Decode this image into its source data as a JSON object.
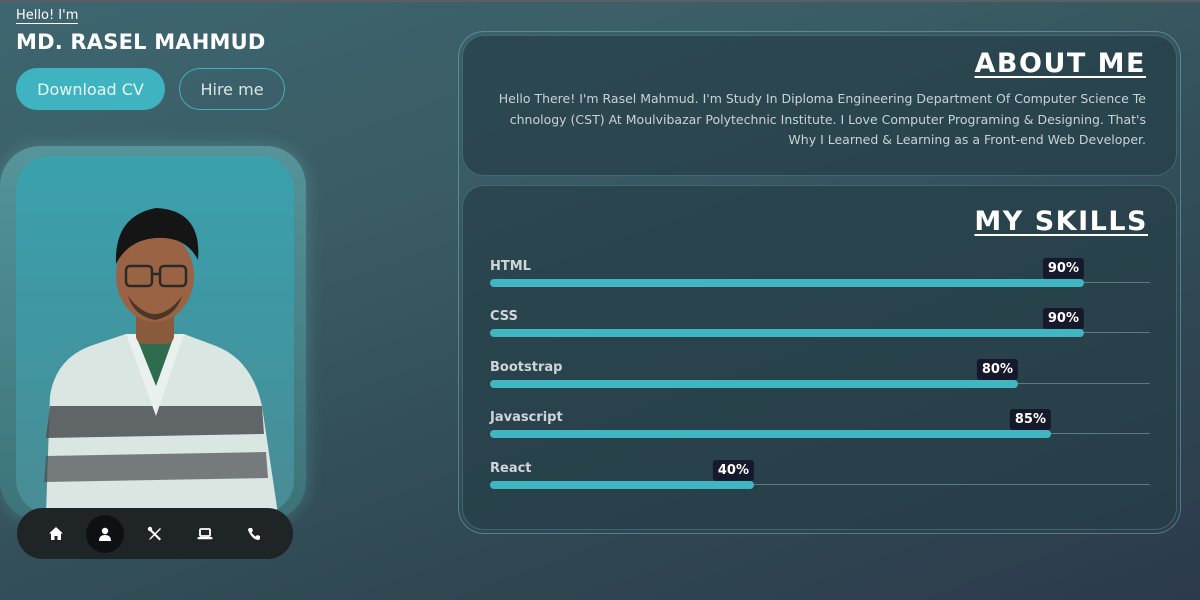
{
  "intro": {
    "greeting": "Hello! I'm",
    "name": "MD. RASEL MAHMUD"
  },
  "buttons": {
    "download": "Download CV",
    "hire": "Hire me"
  },
  "nav": {
    "items": [
      {
        "icon": "home-icon",
        "active": false
      },
      {
        "icon": "user-icon",
        "active": true
      },
      {
        "icon": "tools-icon",
        "active": false
      },
      {
        "icon": "laptop-icon",
        "active": false
      },
      {
        "icon": "phone-icon",
        "active": false
      }
    ]
  },
  "about": {
    "title": "ABOUT ME",
    "text": "Hello There! I'm Rasel Mahmud. I'm Study In Diploma Engineering Department Of Computer Science Te chnology (CST) At Moulvibazar Polytechnic Institute. I Love Computer Programing & Designing. That's Why I Learned & Learning as a Front-end Web Developer."
  },
  "skills": {
    "title": "MY SKILLS",
    "items": [
      {
        "name": "HTML",
        "percent": 90,
        "label": "90%"
      },
      {
        "name": "CSS",
        "percent": 90,
        "label": "90%"
      },
      {
        "name": "Bootstrap",
        "percent": 80,
        "label": "80%"
      },
      {
        "name": "Javascript",
        "percent": 85,
        "label": "85%"
      },
      {
        "name": "React",
        "percent": 40,
        "label": "40%"
      }
    ]
  },
  "colors": {
    "accent": "#40b6c3",
    "badge": "#16182c"
  }
}
